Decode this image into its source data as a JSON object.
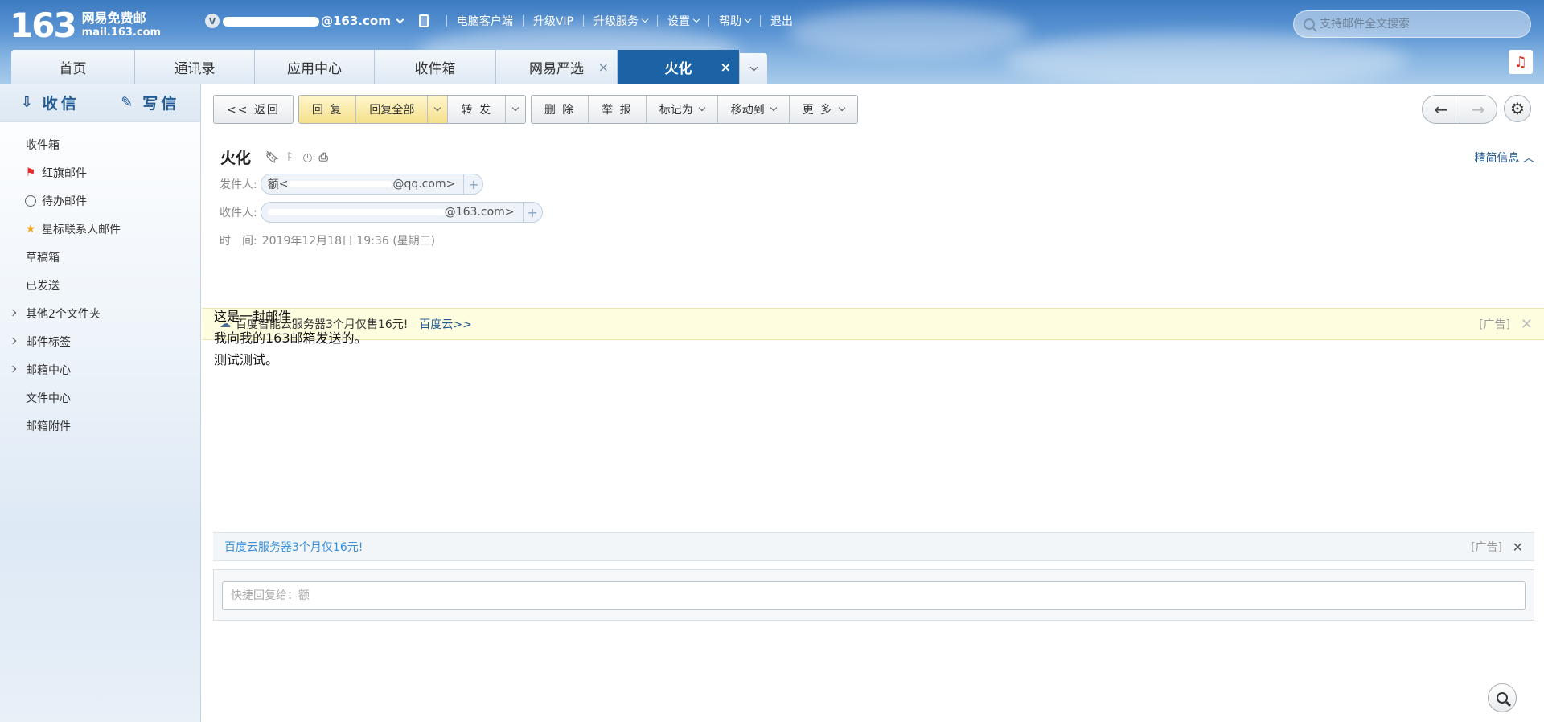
{
  "header": {
    "logo_number": "163",
    "logo_cn": "网易免费邮",
    "logo_en": "mail.163.com",
    "vip_badge": "V",
    "account_suffix": "@163.com",
    "nav": [
      "电脑客户端",
      "升级VIP",
      "升级服务",
      "设置",
      "帮助",
      "退出"
    ],
    "search_placeholder": "支持邮件全文搜索"
  },
  "tabs": [
    {
      "label": "首页"
    },
    {
      "label": "通讯录"
    },
    {
      "label": "应用中心"
    },
    {
      "label": "收件箱"
    },
    {
      "label": "网易严选",
      "close": "×"
    },
    {
      "label": "火化",
      "close": "×"
    }
  ],
  "sidebar": {
    "receive": "收信",
    "write": "写信",
    "items": [
      "收件箱",
      "红旗邮件",
      "待办邮件",
      "星标联系人邮件",
      "草稿箱",
      "已发送",
      "其他2个文件夹",
      "邮件标签",
      "邮箱中心",
      "文件中心",
      "邮箱附件"
    ]
  },
  "toolbar": {
    "back": "<< 返回",
    "reply": "回 复",
    "reply_all": "回复全部",
    "forward": "转 发",
    "delete": "删 除",
    "report": "举 报",
    "mark_as": "标记为",
    "move_to": "移动到",
    "more": "更 多"
  },
  "mail": {
    "subject": "火化",
    "brief": "精简信息",
    "from_label": "发件人:",
    "from_name": "额",
    "from_addr_end": "@qq.com>",
    "to_label": "收件人:",
    "to_addr_end": "@163.com>",
    "time_label": "时　间:",
    "time_value": "2019年12月18日 19:36 (星期三)",
    "body": [
      "这是一封邮件,",
      "我向我的163邮箱发送的。",
      "测试测试。"
    ]
  },
  "ad_top": {
    "text": "百度智能云服务器3个月仅售16元!",
    "link": "百度云>>",
    "tag": "[广告]"
  },
  "ad_bottom": {
    "link": "百度云服务器3个月仅16元!",
    "tag": "[广告]"
  },
  "quick_reply_placeholder": "快捷回复给：额"
}
